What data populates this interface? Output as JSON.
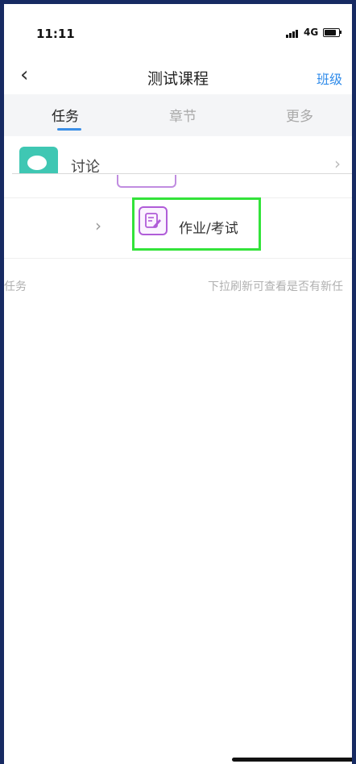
{
  "status_bar": {
    "time": "11:11",
    "network": "4G"
  },
  "nav": {
    "title": "测试课程",
    "right_link": "班级"
  },
  "tabs": [
    {
      "label": "任务",
      "active": true
    },
    {
      "label": "章节",
      "active": false
    },
    {
      "label": "更多",
      "active": false
    }
  ],
  "list": {
    "discussion_label": "讨论",
    "homework_label": "作业/考试"
  },
  "info": {
    "left_text": "任务",
    "right_text": "下拉刷新可查看是否有新任"
  },
  "colors": {
    "accent": "#2f8bea",
    "highlight": "#33e33a",
    "discussion_icon": "#3fc7b3",
    "homework_icon": "#b05cd8",
    "frame": "#172a62"
  },
  "icons": [
    "back-icon",
    "chevron-right-icon",
    "discussion-icon",
    "homework-icon",
    "signal-icon",
    "battery-icon"
  ]
}
